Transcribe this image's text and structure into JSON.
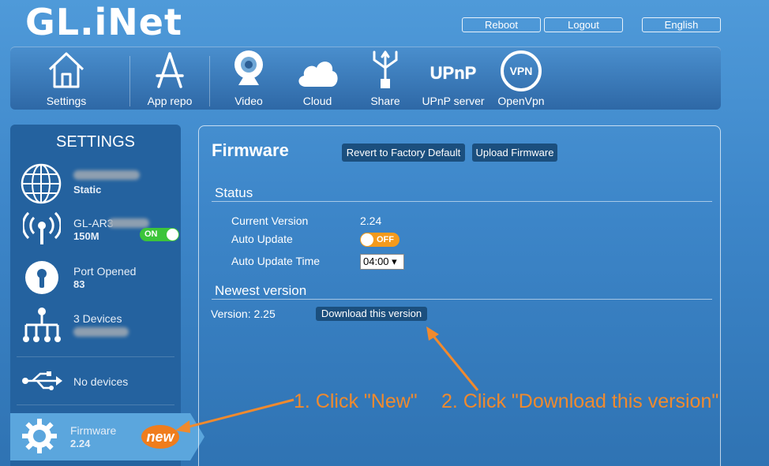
{
  "logo": {
    "text": "GL.iNet"
  },
  "top_buttons": {
    "reboot": "Reboot",
    "logout": "Logout",
    "language": "English"
  },
  "nav": {
    "items": [
      {
        "label": "Settings",
        "icon": "home-icon"
      },
      {
        "label": "App repo",
        "icon": "app-store-icon"
      },
      {
        "label": "Video",
        "icon": "webcam-icon"
      },
      {
        "label": "Cloud",
        "icon": "cloud-icon"
      },
      {
        "label": "Share",
        "icon": "usb-share-icon"
      },
      {
        "label": "UPnP server",
        "icon": "upnp-icon",
        "icon_text": "UPnP"
      },
      {
        "label": "OpenVpn",
        "icon": "vpn-icon",
        "icon_text": "VPN"
      }
    ]
  },
  "sidebar": {
    "title": "SETTINGS",
    "internet": {
      "line2": "Static",
      "icon": "globe-icon"
    },
    "wifi": {
      "line1": "GL-AR3",
      "line2": "150M",
      "toggle": "ON",
      "icon": "wifi-antenna-icon"
    },
    "port": {
      "line1": "Port Opened",
      "line2": "83",
      "icon": "keyhole-icon"
    },
    "devices": {
      "line1": "3 Devices",
      "icon": "network-tree-icon"
    },
    "usb": {
      "line1": "No devices",
      "icon": "usb-icon"
    },
    "firmware": {
      "line1": "Firmware",
      "line2": "2.24",
      "badge": "new",
      "icon": "gear-icon"
    }
  },
  "firmware_panel": {
    "title": "Firmware",
    "revert_button": "Revert to Factory Default",
    "upload_button": "Upload Firmware",
    "status": {
      "title": "Status",
      "current_version_label": "Current Version",
      "current_version": "2.24",
      "auto_update_label": "Auto Update",
      "auto_update_toggle": "OFF",
      "auto_update_time_label": "Auto Update Time",
      "auto_update_time": "04:00 ▾"
    },
    "newest": {
      "title": "Newest version",
      "version_text": "Version: 2.25",
      "download_button": "Download this version"
    }
  },
  "annotations": {
    "step1": "1. Click \"New\"",
    "step2": "2. Click \"Download this version\"",
    "color": "#f08a2e"
  }
}
